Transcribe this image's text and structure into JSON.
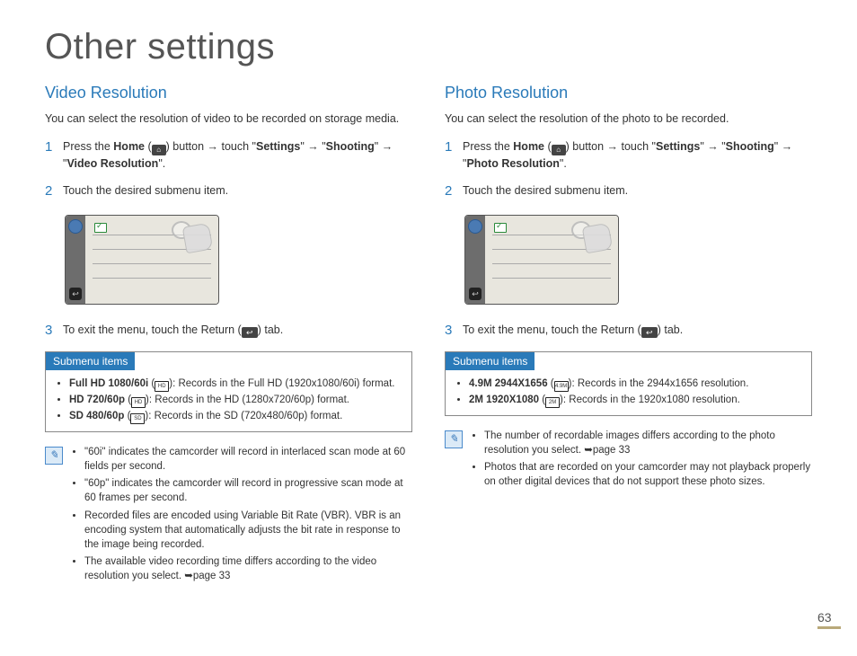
{
  "page_title": "Other settings",
  "page_number": "63",
  "left": {
    "heading": "Video Resolution",
    "intro": "You can select the resolution of video to be recorded on storage media.",
    "steps": {
      "s1_a": "Press the ",
      "s1_home": "Home",
      "s1_b": " button → touch \"",
      "s1_settings": "Settings",
      "s1_c": "\" → \"",
      "s1_shooting": "Shooting",
      "s1_d": "\" → \"",
      "s1_target": "Video Resolution",
      "s1_e": "\".",
      "s2": "Touch the desired submenu item.",
      "s3_a": "To exit the menu, touch the Return (",
      "s3_b": ") tab."
    },
    "submenu_title": "Submenu items",
    "submenu": [
      {
        "name": "Full HD 1080/60i",
        "icon": "HD",
        "desc": "Records in the Full HD (1920x1080/60i) format."
      },
      {
        "name": "HD 720/60p",
        "icon": "HD",
        "desc": "Records in the HD (1280x720/60p) format."
      },
      {
        "name": "SD 480/60p",
        "icon": "SD",
        "desc": "Records in the SD (720x480/60p) format."
      }
    ],
    "notes": [
      "\"60i\" indicates the camcorder will record in interlaced scan mode at 60 fields per second.",
      "\"60p\" indicates the camcorder will record in progressive scan mode at 60 frames per second.",
      "Recorded files are encoded using Variable Bit Rate (VBR). VBR is an encoding system that automatically adjusts the bit rate in response to the image being recorded.",
      "The available video recording time differs according to the video resolution you select. ➥page 33"
    ]
  },
  "right": {
    "heading": "Photo Resolution",
    "intro": "You can select the resolution of the photo to be recorded.",
    "steps": {
      "s1_a": "Press the ",
      "s1_home": "Home",
      "s1_b": " button → touch \"",
      "s1_settings": "Settings",
      "s1_c": "\" → \"",
      "s1_shooting": "Shooting",
      "s1_d": "\" → \"",
      "s1_target": "Photo Resolution",
      "s1_e": "\".",
      "s2": "Touch the desired submenu item.",
      "s3_a": "To exit the menu, touch the Return (",
      "s3_b": ") tab."
    },
    "submenu_title": "Submenu items",
    "submenu": [
      {
        "name": "4.9M 2944X1656",
        "icon": "4.9M",
        "desc": "Records in the 2944x1656 resolution."
      },
      {
        "name": "2M 1920X1080",
        "icon": "2M",
        "desc": "Records in the 1920x1080 resolution."
      }
    ],
    "notes": [
      "The number of recordable images differs according to the photo resolution you select. ➥page 33",
      "Photos that are recorded on your camcorder may not playback properly on other digital devices that do not support these photo sizes."
    ]
  }
}
